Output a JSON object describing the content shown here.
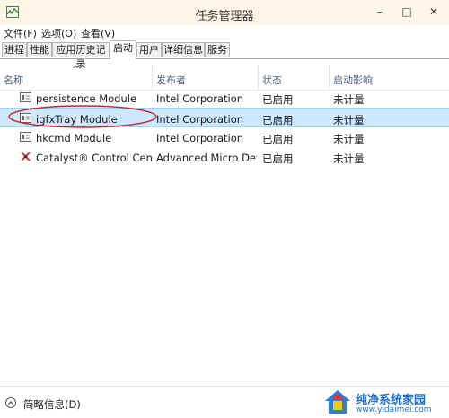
{
  "window": {
    "title": "任务管理器",
    "controls": {
      "minimize": "–",
      "maximize": "□",
      "close": "✕"
    }
  },
  "menu": [
    {
      "label": "文件(F)"
    },
    {
      "label": "选项(O)"
    },
    {
      "label": "查看(V)"
    }
  ],
  "tabs": [
    {
      "label": "进程"
    },
    {
      "label": "性能"
    },
    {
      "label": "应用历史记录"
    },
    {
      "label": "启动",
      "active": true
    },
    {
      "label": "用户"
    },
    {
      "label": "详细信息"
    },
    {
      "label": "服务"
    }
  ],
  "columns": [
    {
      "label": "名称"
    },
    {
      "label": "发布者"
    },
    {
      "label": "状态"
    },
    {
      "label": "启动影响"
    }
  ],
  "sort_arrow": "^",
  "rows": [
    {
      "name": "persistence Module",
      "publisher": "Intel Corporation",
      "status": "已启用",
      "impact": "未计量",
      "icon": "module-icon"
    },
    {
      "name": "igfxTray Module",
      "publisher": "Intel Corporation",
      "status": "已启用",
      "impact": "未计量",
      "icon": "module-icon",
      "selected": true
    },
    {
      "name": "hkcmd Module",
      "publisher": "Intel Corporation",
      "status": "已启用",
      "impact": "未计量",
      "icon": "module-icon"
    },
    {
      "name": "Catalyst® Control Center ...",
      "publisher": "Advanced Micro Devi...",
      "status": "已启用",
      "impact": "未计量",
      "icon": "catalyst-icon"
    }
  ],
  "footer": {
    "less_details": "简略信息(D)"
  },
  "watermark": {
    "text": "纯净系统家园",
    "url": "www.yidaimei.com"
  },
  "colors": {
    "selected_row": "#cce8ff",
    "annotation_circle": "#c0262c",
    "header_text": "#4c607a",
    "watermark": "#1e6fc8"
  }
}
